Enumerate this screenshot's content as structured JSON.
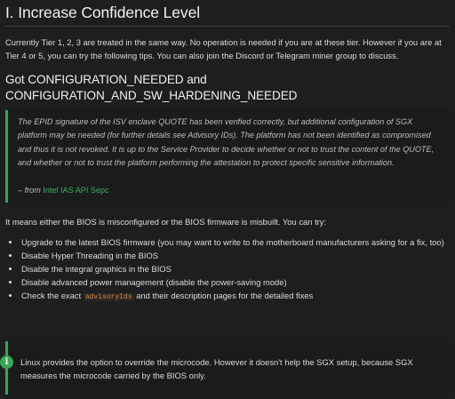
{
  "heading": "I. Increase Confidence Level",
  "intro": "Currently Tier 1, 2, 3 are treated in the same way. No operation is needed if you are at these tier. However if you are at Tier 4 or 5, you can try the following tips. You can also join the Discord or Telegram miner group to discuss.",
  "subheading": {
    "line1": "Got CONFIGURATION_NEEDED and",
    "line2": "CONFIGURATION_AND_SW_HARDENING_NEEDED"
  },
  "quote": {
    "text": "The EPID signature of the ISV enclave QUOTE has been verified correctly, but additional configuration of SGX platform may be needed (for further details see Advisory IDs). The platform has not been identified as compromised and thus it is not revoked. It is up to the Service Provider to decide whether or not to trust the content of the QUOTE, and whether or not to trust the platform performing the attestation to protect specific sensitive information.",
    "from_prefix": "– from ",
    "link_text": "Intel IAS API Sepc"
  },
  "body": "It means either the BIOS is misconfigured or the BIOS firmware is misbuilt. You can try:",
  "list": {
    "item0": "Upgrade to the latest BIOS firmware (you may want to write to the motherboard manufacturers asking for a fix, too)",
    "item1": "Disable Hyper Threading in the BIOS",
    "item2": "Disable the integral graphics in the BIOS",
    "item3": "Disable advanced power management (disable the power-saving mode)",
    "item4_pre": "Check the exact ",
    "item4_code": "advisoryIds",
    "item4_post": " and their description pages for the detailed fixes"
  },
  "tip": {
    "icon": "info-icon",
    "glyph": "i",
    "text": "Linux provides the option to override the microcode. However it doesn't help the SGX setup, because SGX measures the microcode carried by the BIOS only."
  },
  "colors": {
    "accent": "#35a853",
    "background": "#1e1e1f",
    "code": "#d28c3f"
  }
}
